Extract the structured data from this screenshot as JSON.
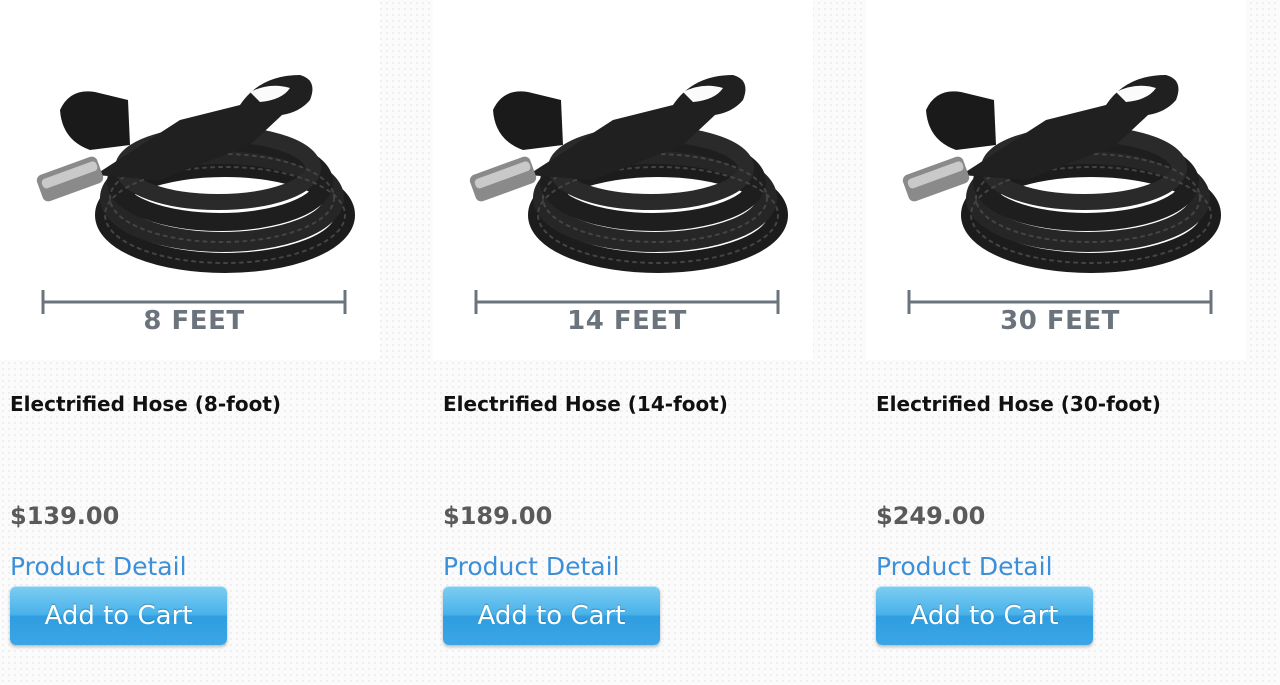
{
  "products": [
    {
      "length_label": "8 FEET",
      "title": "Electrified Hose (8-foot)",
      "price": "$139.00",
      "detail_label": "Product Detail",
      "cart_label": "Add to Cart"
    },
    {
      "length_label": "14 FEET",
      "title": "Electrified Hose (14-foot)",
      "price": "$189.00",
      "detail_label": "Product Detail",
      "cart_label": "Add to Cart"
    },
    {
      "length_label": "30 FEET",
      "title": "Electrified Hose (30-foot)",
      "price": "$249.00",
      "detail_label": "Product Detail",
      "cart_label": "Add to Cart"
    }
  ],
  "colors": {
    "link": "#3c8fd9",
    "button": "#4ab2ea",
    "price": "#5a5a5a",
    "dimension_line": "#6b747d"
  },
  "icons": {
    "product_image": "coiled-vacuum-hose-image"
  }
}
